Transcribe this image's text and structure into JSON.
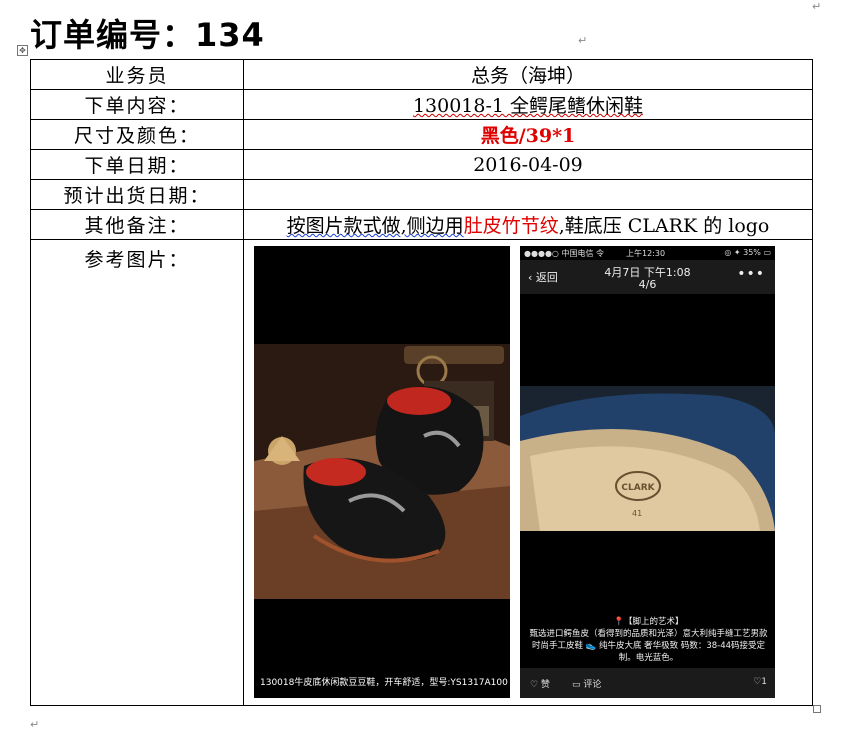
{
  "document": {
    "title": "订单编号：134"
  },
  "rows": [
    {
      "label": "业务员",
      "value": "总务（海坤）"
    },
    {
      "label": "下单内容：",
      "value": "130018-1 全鳄尾鳍休闲鞋"
    },
    {
      "label": "尺寸及颜色：",
      "value": "黑色/39*1"
    },
    {
      "label": "下单日期：",
      "value": "2016-04-09"
    },
    {
      "label": "预计出货日期：",
      "value": ""
    },
    {
      "label": "其他备注：",
      "value_parts": [
        "按图片款式做,侧边用",
        "肚皮竹节纹",
        ",鞋底压 CLARK 的 logo"
      ]
    },
    {
      "label": "参考图片："
    }
  ],
  "photo1": {
    "caption": "130018牛皮底休闲款豆豆鞋，开车舒适，型号:YS1317A100"
  },
  "photo2": {
    "status": {
      "carrier": "●●●●○ 中国电信 令",
      "time": "上午12:30",
      "battery": "◎ ✦ 35% ▭"
    },
    "nav": {
      "back": "返回",
      "date": "4月7日 下午1:08",
      "page": "4/6",
      "more": "•••"
    },
    "desc_title": "📍【脚上的艺术】",
    "desc_body": "甄选进口鳄鱼皮（看得到的品质和光泽）意大利纯手缝工艺男款时尚手工皮鞋 👟 纯牛皮大底 奢华极致 码数：38-44码接受定制。电光蓝色。",
    "sole_text": "CLARK",
    "sole_size": "41",
    "bar": {
      "like": "♡ 赞",
      "comment": "▭ 评论",
      "count": "♡1"
    }
  },
  "colors": {
    "highlight": "#e00000"
  }
}
